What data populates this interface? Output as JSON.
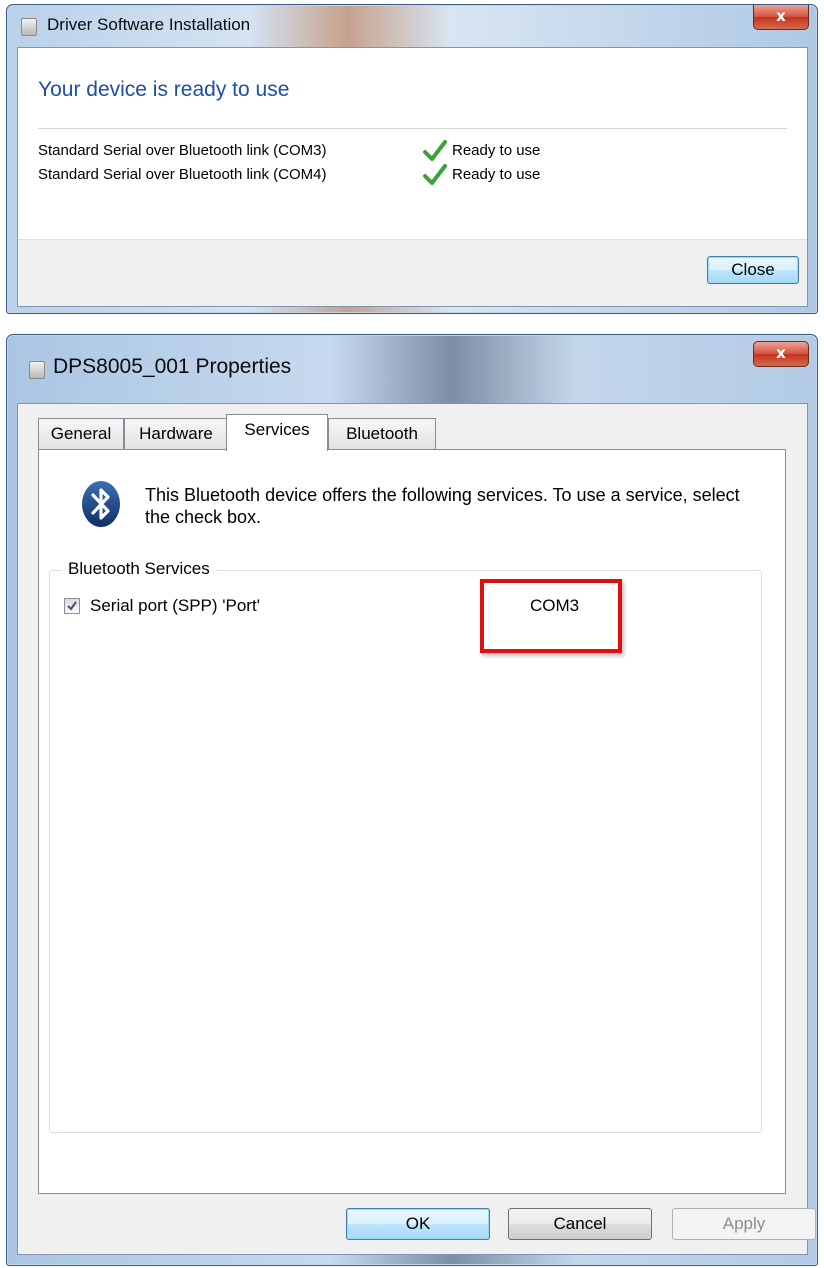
{
  "driver_window": {
    "title": "Driver Software Installation",
    "close_glyph": "x",
    "heading": "Your device is ready to use",
    "devices": [
      {
        "name": "Standard Serial over Bluetooth link (COM3)",
        "status": "Ready to use",
        "icon": "green-check-icon"
      },
      {
        "name": "Standard Serial over Bluetooth link (COM4)",
        "status": "Ready to use",
        "icon": "green-check-icon"
      }
    ],
    "close_button": "Close"
  },
  "properties_window": {
    "title": "DPS8005_001 Properties",
    "close_glyph": "x",
    "tabs": [
      "General",
      "Hardware",
      "Services",
      "Bluetooth"
    ],
    "active_tab": "Services",
    "info_text": "This Bluetooth device offers the following services. To use a service, select the check box.",
    "group_label": "Bluetooth Services",
    "services": [
      {
        "label": "Serial port (SPP) 'Port'",
        "checked": true,
        "port": "COM3"
      }
    ],
    "buttons": {
      "ok": "OK",
      "cancel": "Cancel",
      "apply": "Apply"
    }
  },
  "colors": {
    "heading_blue": "#1e4ea6",
    "highlight_red": "#e01010",
    "check_green": "#3aa335"
  }
}
